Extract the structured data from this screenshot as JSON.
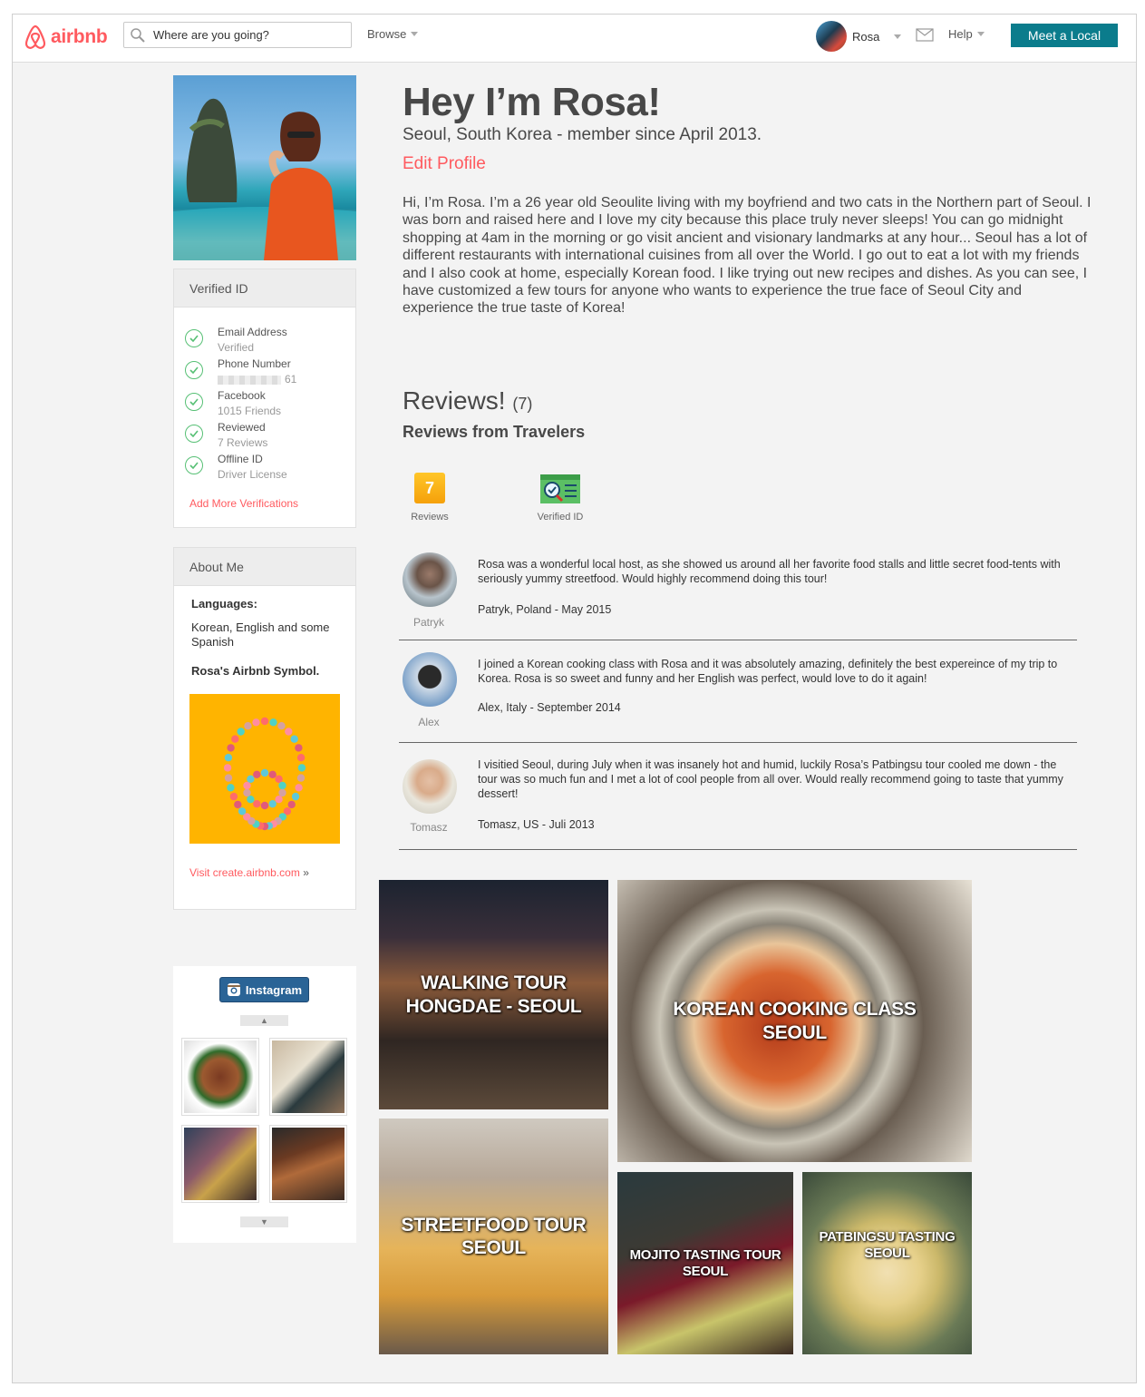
{
  "header": {
    "logo_text": "airbnb",
    "search_placeholder": "Where are you going?",
    "browse_label": "Browse",
    "user_name": "Rosa",
    "help_label": "Help",
    "cta_label": "Meet a Local"
  },
  "profile": {
    "greeting": "Hey I’m Rosa!",
    "location": "Seoul, South Korea - member since April 2013.",
    "edit_label": "Edit Profile",
    "bio": "Hi, I’m Rosa. I’m a 26 year old Seoulite living with my boyfriend and two cats in the Northern part of Seoul. I was born and raised here and I love my city because this place truly never sleeps! You can go midnight shopping at 4am in the morning or go visit ancient and visionary landmarks at any hour... Seoul has a lot of different restaurants with international cuisines from all over the World. I go out to eat a lot with my friends and I also cook at home, especially Korean food. I like trying out new recipes and dishes. As you can see, I have customized a few tours for anyone who wants to experience the true face of Seoul City and experience the true taste of Korea!"
  },
  "verified": {
    "title": "Verified ID",
    "items": [
      {
        "label": "Email Address",
        "detail": "Verified"
      },
      {
        "label": "Phone Number",
        "detail": "61"
      },
      {
        "label": "Facebook",
        "detail": "1015 Friends"
      },
      {
        "label": "Reviewed",
        "detail": "7 Reviews"
      },
      {
        "label": "Offline ID",
        "detail": "Driver License"
      }
    ],
    "add_link": "Add More Verifications"
  },
  "about": {
    "title": "About Me",
    "languages_label": "Languages:",
    "languages_value": "Korean, English and some Spanish",
    "symbol_label": "Rosa's Airbnb Symbol.",
    "visit_link": "Visit create.airbnb.com",
    "visit_arrow": "»"
  },
  "reviews": {
    "title": "Reviews!",
    "count": "(7)",
    "subtitle": "Reviews from Travelers",
    "badges": [
      {
        "icon_text": "7",
        "label": "Reviews"
      },
      {
        "label": "Verified ID"
      }
    ],
    "items": [
      {
        "name": "Patryk",
        "text": "Rosa was a wonderful local host, as she showed us around all her favorite food stalls and little secret food-tents with seriously yummy streetfood. Would highly recommend doing this tour!",
        "meta": "Patryk, Poland - May 2015"
      },
      {
        "name": "Alex",
        "text": "I joined a Korean cooking class with Rosa and it was absolutely amazing, definitely the best expereince of my trip to Korea. Rosa is so sweet and funny and her English was perfect, would love to do it again!",
        "meta": "Alex, Italy - September 2014"
      },
      {
        "name": "Tomasz",
        "text": "I visitied Seoul, during July when it was insanely hot and humid, luckily Rosa’s Patbingsu tour cooled me down - the tour was so much fun and I met a lot of cool people from all over. Would really recommend going to taste that yummy dessert!",
        "meta": "Tomasz, US - Juli 2013"
      }
    ]
  },
  "tours": [
    {
      "line1": "WALKING TOUR",
      "line2": "HONGDAE - SEOUL"
    },
    {
      "line1": "KOREAN COOKING CLASS",
      "line2": "SEOUL"
    },
    {
      "line1": "STREETFOOD TOUR",
      "line2": "SEOUL"
    },
    {
      "line1": "MOJITO TASTING TOUR",
      "line2": "SEOUL"
    },
    {
      "line1": "PATBINGSU TASTING",
      "line2": "SEOUL"
    }
  ],
  "instagram": {
    "button_label": "Instagram"
  },
  "colors": {
    "brand": "#ff5a5f",
    "cta": "#0b7c8c",
    "verified": "#57c075",
    "symbol_bg": "#ffb400"
  }
}
